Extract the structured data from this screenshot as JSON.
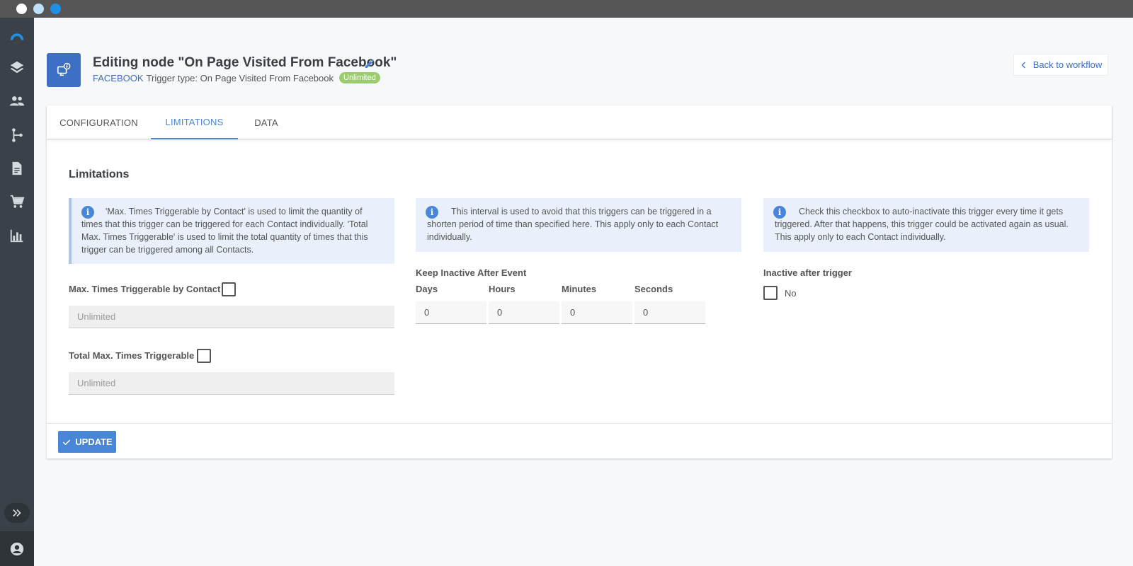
{
  "header": {
    "title": "Editing node \"On Page Visited From Facebook\"",
    "platform": "FACEBOOK",
    "trigger_type": "Trigger type: On Page Visited From Facebook",
    "badge": "Unlimited",
    "back_label": "Back to workflow"
  },
  "tabs": [
    {
      "label": "CONFIGURATION"
    },
    {
      "label": "LIMITATIONS"
    },
    {
      "label": "DATA"
    }
  ],
  "limitations": {
    "title": "Limitations",
    "info_contact": "'Max. Times Triggerable by Contact' is used to limit the quantity of times that this trigger can be triggered for each Contact individually. 'Total Max. Times Triggerable' is used to limit the total quantity of times that this trigger can be triggered among all Contacts.",
    "info_interval": "This interval is used to avoid that this triggers can be triggered in a shorten period of time than specified here. This apply only to each Contact individually.",
    "info_inactive": "Check this checkbox to auto-inactivate this trigger every time it gets triggered. After that happens, this trigger could be activated again as usual. This apply only to each Contact individually.",
    "max_by_contact_label": "Max. Times Triggerable by Contact",
    "max_by_contact_value": "Unlimited",
    "total_max_label": "Total Max. Times Triggerable",
    "total_max_value": "Unlimited",
    "keep_inactive_label": "Keep Inactive After Event",
    "days_label": "Days",
    "hours_label": "Hours",
    "minutes_label": "Minutes",
    "seconds_label": "Seconds",
    "days_value": "0",
    "hours_value": "0",
    "minutes_value": "0",
    "seconds_value": "0",
    "inactive_after_label": "Inactive after trigger",
    "inactive_after_value": "No"
  },
  "footer": {
    "update_label": "UPDATE"
  },
  "colors": {
    "accent": "#4a86d8",
    "sidebar": "#3b4148",
    "badge": "#9bcd6e"
  },
  "icons": {
    "sidebar": [
      "logo-icon",
      "layers-icon",
      "contacts-icon",
      "workflow-icon",
      "document-icon",
      "cart-icon",
      "analytics-icon",
      "expand-icon",
      "account-icon"
    ]
  }
}
